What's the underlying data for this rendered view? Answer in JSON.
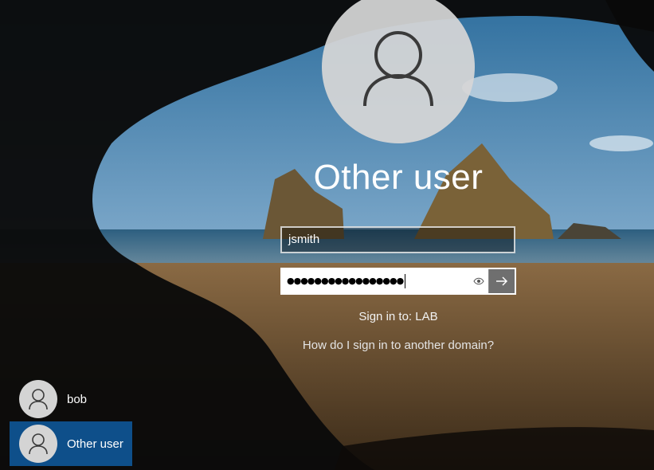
{
  "background": {
    "description_icon": "beach-cave-wallpaper",
    "colors": {
      "sky": "#4f86b3",
      "sand": "#7a5a35",
      "cave": "#0a0a0a"
    }
  },
  "login": {
    "title": "Other user",
    "username_value": "jsmith",
    "password_masked": "●●●●●●●●●●●●●●●●●",
    "reveal_icon": "eye-icon",
    "submit_icon": "arrow-right-icon",
    "sign_in_to": "Sign in to: LAB",
    "domain_link": "How do I sign in to another domain?"
  },
  "user_list": [
    {
      "label": "bob",
      "icon": "user-icon",
      "selected": false
    },
    {
      "label": "Other user",
      "icon": "user-icon",
      "selected": true
    }
  ],
  "accent_color": "#0e4f8a"
}
